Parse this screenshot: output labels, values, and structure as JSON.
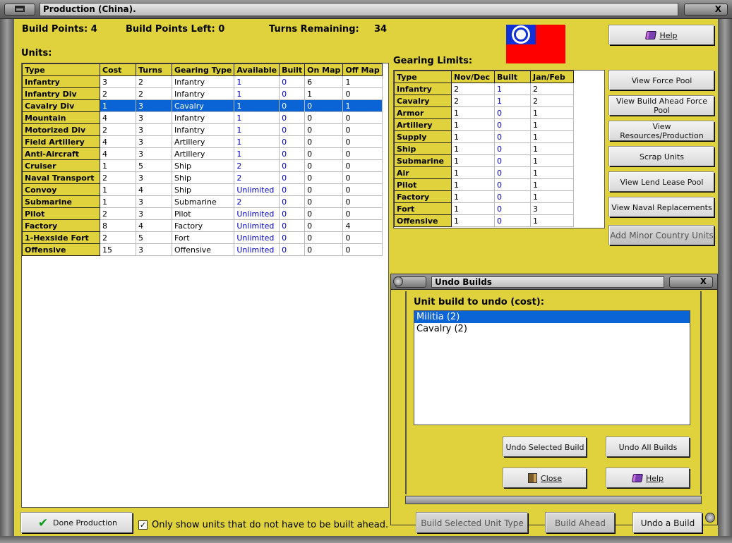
{
  "window": {
    "title": "Production (China).",
    "close_label": "X"
  },
  "stats": {
    "build_points": "Build Points: 4",
    "build_points_left": "Build Points Left:  0",
    "turns_remaining_label": "Turns Remaining:",
    "turns_remaining_value": "34"
  },
  "units": {
    "heading": "Units:",
    "columns": [
      "Type",
      "Cost",
      "Turns",
      "Gearing Type",
      "Available",
      "Built",
      "On Map",
      "Off Map"
    ],
    "rows": [
      [
        "Infantry",
        "3",
        "2",
        "Infantry",
        "1",
        "0",
        "6",
        "1"
      ],
      [
        "Infantry Div",
        "2",
        "2",
        "Infantry",
        "1",
        "0",
        "1",
        "0"
      ],
      [
        "Cavalry Div",
        "1",
        "3",
        "Cavalry",
        "1",
        "0",
        "0",
        "1"
      ],
      [
        "Mountain",
        "4",
        "3",
        "Infantry",
        "1",
        "0",
        "0",
        "0"
      ],
      [
        "Motorized Div",
        "2",
        "3",
        "Infantry",
        "1",
        "0",
        "0",
        "0"
      ],
      [
        "Field Artillery",
        "4",
        "3",
        "Artillery",
        "1",
        "0",
        "0",
        "0"
      ],
      [
        "Anti-Aircraft",
        "4",
        "3",
        "Artillery",
        "1",
        "0",
        "0",
        "0"
      ],
      [
        "Cruiser",
        "1",
        "5",
        "Ship",
        "2",
        "0",
        "0",
        "0"
      ],
      [
        "Naval Transport",
        "2",
        "3",
        "Ship",
        "2",
        "0",
        "0",
        "0"
      ],
      [
        "Convoy",
        "1",
        "4",
        "Ship",
        "Unlimited",
        "0",
        "0",
        "0"
      ],
      [
        "Submarine",
        "1",
        "3",
        "Submarine",
        "2",
        "0",
        "0",
        "0"
      ],
      [
        "Pilot",
        "2",
        "3",
        "Pilot",
        "Unlimited",
        "0",
        "0",
        "0"
      ],
      [
        "Factory",
        "8",
        "4",
        "Factory",
        "Unlimited",
        "0",
        "0",
        "4"
      ],
      [
        "1-Hexside Fort",
        "2",
        "5",
        "Fort",
        "Unlimited",
        "0",
        "0",
        "0"
      ],
      [
        "Offensive",
        "15",
        "3",
        "Offensive",
        "Unlimited",
        "0",
        "0",
        "0"
      ]
    ],
    "selected_row": 2
  },
  "gearing": {
    "heading": "Gearing Limits:",
    "columns": [
      "Type",
      "Nov/Dec",
      "Built",
      "Jan/Feb"
    ],
    "rows": [
      [
        "Infantry",
        "2",
        "1",
        "2"
      ],
      [
        "Cavalry",
        "2",
        "1",
        "2"
      ],
      [
        "Armor",
        "1",
        "0",
        "1"
      ],
      [
        "Artillery",
        "1",
        "0",
        "1"
      ],
      [
        "Supply",
        "1",
        "0",
        "1"
      ],
      [
        "Ship",
        "1",
        "0",
        "1"
      ],
      [
        "Submarine",
        "1",
        "0",
        "1"
      ],
      [
        "Air",
        "1",
        "0",
        "1"
      ],
      [
        "Pilot",
        "1",
        "0",
        "1"
      ],
      [
        "Factory",
        "1",
        "0",
        "1"
      ],
      [
        "Fort",
        "1",
        "0",
        "3"
      ],
      [
        "Offensive",
        "1",
        "0",
        "1"
      ]
    ]
  },
  "right_buttons": {
    "help": "Help",
    "view_force_pool": "View Force Pool",
    "view_build_ahead": "View Build Ahead Force Pool",
    "view_resources": "View Resources/Production",
    "scrap_units": "Scrap Units",
    "view_lend_lease": "View Lend Lease Pool",
    "view_naval_replacements": "View Naval Replacements",
    "add_minor": "Add Minor Country Units"
  },
  "undo": {
    "title": "Undo Builds",
    "close_label": "X",
    "prompt": "Unit build to undo (cost):",
    "items": [
      "Militia (2)",
      "Cavalry (2)"
    ],
    "selected": 0,
    "undo_selected": "Undo Selected Build",
    "undo_all": "Undo All Builds",
    "close": "Close",
    "help": "Help"
  },
  "bottom": {
    "done": "Done Production",
    "checkbox_label": "Only show units that do not have to be built ahead.",
    "checkbox_checked": true,
    "build_selected": "Build Selected Unit Type",
    "build_ahead": "Build Ahead",
    "undo_build": "Undo a Build"
  },
  "colors": {
    "panel": "#e0d23c",
    "selection": "#0a64d6",
    "value_blue": "#0000cc",
    "flag_red": "#ff0000",
    "flag_blue": "#1030d8"
  }
}
